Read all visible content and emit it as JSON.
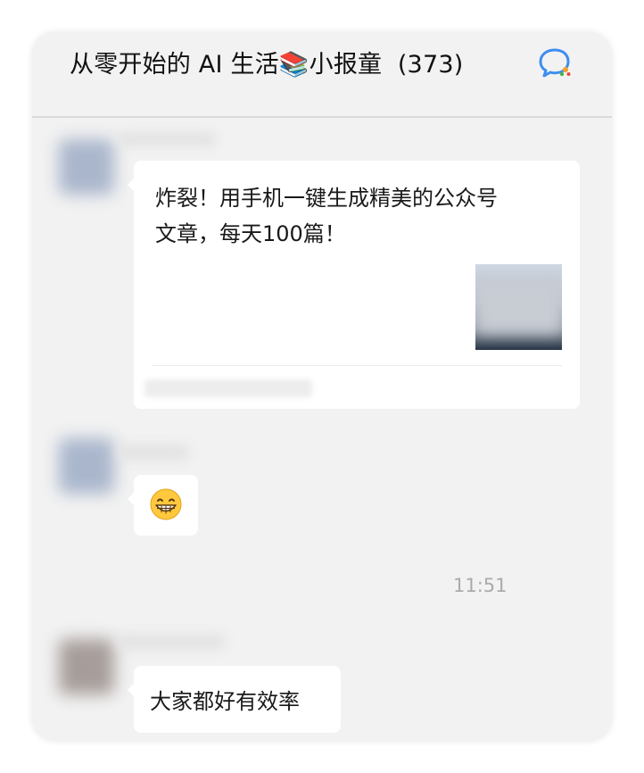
{
  "header": {
    "title_text": "从零开始的 AI 生活",
    "title_emoji": "📚",
    "title_suffix": "小报童",
    "member_count": "(373)",
    "chat_icon": "chat-bubble-sparkle-icon"
  },
  "messages": [
    {
      "type": "article-card",
      "title": "炸裂！用手机一键生成精美的公众号\n文章，每天100篇！"
    },
    {
      "type": "emoji",
      "emoji": "😁"
    },
    {
      "type": "timestamp",
      "time": "11:51"
    },
    {
      "type": "text",
      "text": "大家都好有效率"
    }
  ],
  "colors": {
    "panel_bg": "#f2f2f2",
    "bubble_bg": "#ffffff",
    "icon_blue": "#3d8ef0",
    "icon_orange": "#f7a024"
  }
}
